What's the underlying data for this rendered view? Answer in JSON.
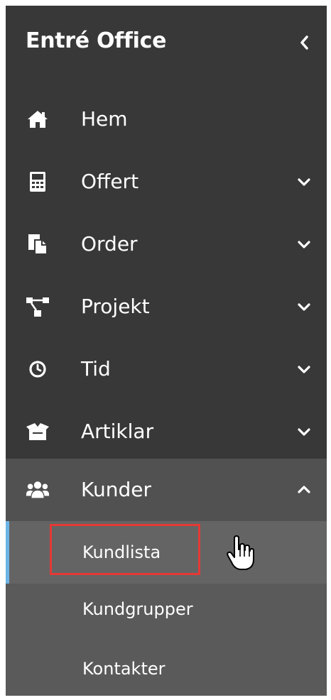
{
  "app": {
    "title": "Entré Office"
  },
  "nav": {
    "items": [
      {
        "label": "Hem",
        "icon": "home-icon",
        "has_chevron": false
      },
      {
        "label": "Offert",
        "icon": "calculator-icon",
        "chevron": "down"
      },
      {
        "label": "Order",
        "icon": "documents-icon",
        "chevron": "down"
      },
      {
        "label": "Projekt",
        "icon": "sitemap-icon",
        "chevron": "down"
      },
      {
        "label": "Tid",
        "icon": "clock-icon",
        "chevron": "down"
      },
      {
        "label": "Artiklar",
        "icon": "box-icon",
        "chevron": "down"
      },
      {
        "label": "Kunder",
        "icon": "users-icon",
        "chevron": "up",
        "expanded": true
      }
    ],
    "sub_items": [
      {
        "label": "Kundlista",
        "active": true
      },
      {
        "label": "Kundgrupper",
        "active": false
      },
      {
        "label": "Kontakter",
        "active": false
      }
    ]
  },
  "colors": {
    "sidebar_bg": "#383838",
    "expanded_bg": "#515151",
    "submenu_bg": "#5a5a5a",
    "active_sub_bg": "#646464",
    "active_indicator": "#6cb4e6",
    "highlight_box": "#e53935"
  }
}
